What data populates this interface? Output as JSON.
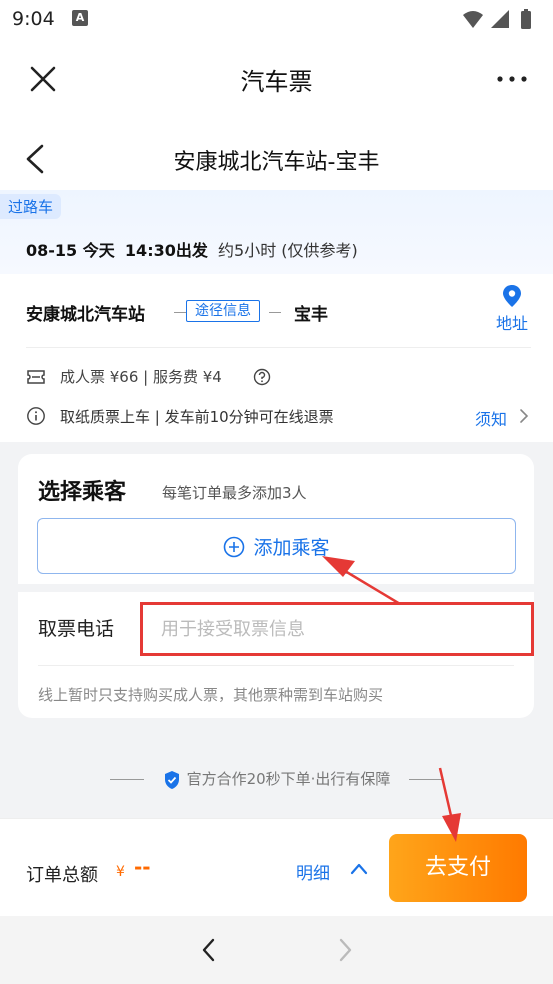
{
  "status": {
    "time": "9:04",
    "notif_glyph": "A"
  },
  "app": {
    "title": "汽车票"
  },
  "route": {
    "title": "安康城北汽车站-宝丰"
  },
  "trip": {
    "tag": "过路车",
    "date": "08-15 今天",
    "depart_time": "14:30出发",
    "duration": "约5小时 (仅供参考)",
    "from": "安康城北汽车站",
    "route_info": "途径信息",
    "to": "宝丰",
    "address_label": "地址",
    "price_text": "成人票 ¥66 | 服务费 ¥4",
    "notice_text": "取纸质票上车 | 发车前10分钟可在线退票",
    "notice_link": "须知"
  },
  "passenger": {
    "title": "选择乘客",
    "hint": "每笔订单最多添加3人",
    "add_label": "添加乘客",
    "phone_label": "取票电话",
    "phone_placeholder": "用于接受取票信息",
    "phone_value": "",
    "footnote": "线上暂时只支持购买成人票，其他票种需到车站购买"
  },
  "guarantee": {
    "text": "官方合作20秒下单·出行有保障"
  },
  "order": {
    "total_label": "订单总额",
    "currency": "¥",
    "total_value": "--",
    "detail_label": "明细",
    "pay_label": "去支付"
  },
  "colors": {
    "accent": "#1a73e8",
    "pay_orange": "#ff7a00",
    "annotation_red": "#e53935"
  }
}
